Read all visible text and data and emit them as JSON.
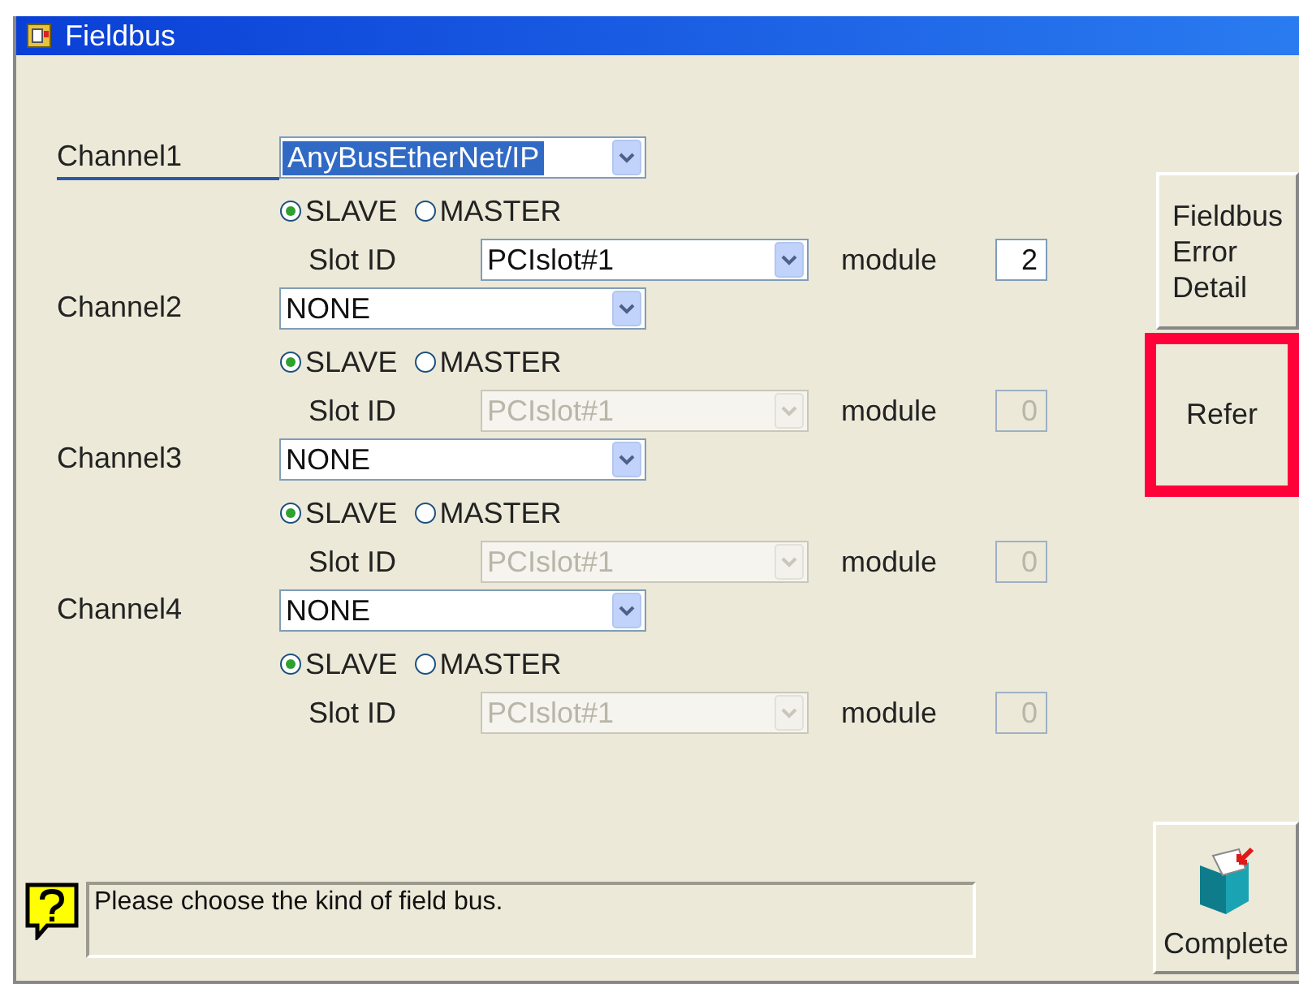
{
  "window": {
    "title": "Fieldbus"
  },
  "channels": [
    {
      "label": "Channel1",
      "selected": true,
      "bus_type": "AnyBusEtherNet/IP",
      "modes": [
        {
          "label": "SLAVE",
          "selected": true
        },
        {
          "label": "MASTER",
          "selected": false
        }
      ],
      "slot_label": "Slot ID",
      "slot": {
        "value": "PCIslot#1",
        "disabled": false
      },
      "module_label": "module",
      "module": {
        "value": "2",
        "disabled": false
      }
    },
    {
      "label": "Channel2",
      "selected": false,
      "bus_type": "NONE",
      "modes": [
        {
          "label": "SLAVE",
          "selected": true
        },
        {
          "label": "MASTER",
          "selected": false
        }
      ],
      "slot_label": "Slot ID",
      "slot": {
        "value": "PCIslot#1",
        "disabled": true
      },
      "module_label": "module",
      "module": {
        "value": "0",
        "disabled": true
      }
    },
    {
      "label": "Channel3",
      "selected": false,
      "bus_type": "NONE",
      "modes": [
        {
          "label": "SLAVE",
          "selected": true
        },
        {
          "label": "MASTER",
          "selected": false
        }
      ],
      "slot_label": "Slot ID",
      "slot": {
        "value": "PCIslot#1",
        "disabled": true
      },
      "module_label": "module",
      "module": {
        "value": "0",
        "disabled": true
      }
    },
    {
      "label": "Channel4",
      "selected": false,
      "bus_type": "NONE",
      "modes": [
        {
          "label": "SLAVE",
          "selected": true
        },
        {
          "label": "MASTER",
          "selected": false
        }
      ],
      "slot_label": "Slot ID",
      "slot": {
        "value": "PCIslot#1",
        "disabled": true
      },
      "module_label": "module",
      "module": {
        "value": "0",
        "disabled": true
      }
    }
  ],
  "error_detail_button": {
    "lines": [
      "Fieldbus",
      "Error",
      "Detail"
    ]
  },
  "refer_button": {
    "label": "Refer",
    "highlighted": true
  },
  "message": "Please choose the kind of field bus.",
  "complete_button": {
    "label": "Complete"
  }
}
